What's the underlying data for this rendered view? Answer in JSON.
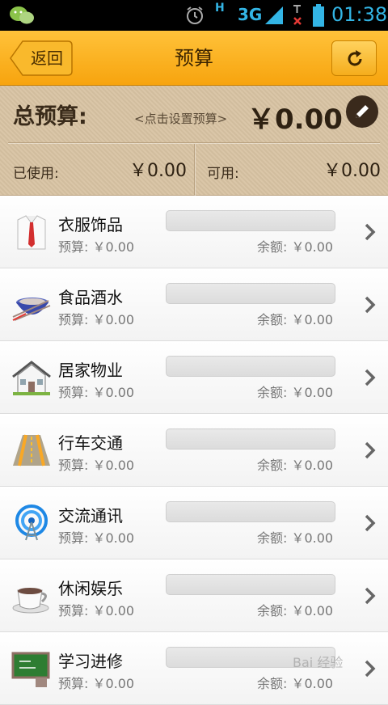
{
  "status_bar": {
    "network_type": "H",
    "network_gen": "3G",
    "time": "01:38"
  },
  "header": {
    "back_label": "返回",
    "title": "预算"
  },
  "summary": {
    "total_label": "总预算:",
    "set_hint": "<点击设置预算>",
    "total_amount": "￥0.00",
    "used_label": "已使用:",
    "used_value": "￥0.00",
    "available_label": "可用:",
    "available_value": "￥0.00"
  },
  "categories": [
    {
      "name": "衣服饰品",
      "budget": "预算: ￥0.00",
      "remaining": "余额: ￥0.00",
      "icon": "shirt-icon",
      "progress": 0
    },
    {
      "name": "食品酒水",
      "budget": "预算: ￥0.00",
      "remaining": "余额: ￥0.00",
      "icon": "food-bowl-icon",
      "progress": 0
    },
    {
      "name": "居家物业",
      "budget": "预算: ￥0.00",
      "remaining": "余额: ￥0.00",
      "icon": "house-icon",
      "progress": 0
    },
    {
      "name": "行车交通",
      "budget": "预算: ￥0.00",
      "remaining": "余额: ￥0.00",
      "icon": "road-icon",
      "progress": 0
    },
    {
      "name": "交流通讯",
      "budget": "预算: ￥0.00",
      "remaining": "余额: ￥0.00",
      "icon": "antenna-icon",
      "progress": 0
    },
    {
      "name": "休闲娱乐",
      "budget": "预算: ￥0.00",
      "remaining": "余额: ￥0.00",
      "icon": "coffee-icon",
      "progress": 0
    },
    {
      "name": "学习进修",
      "budget": "预算: ￥0.00",
      "remaining": "余额: ￥0.00",
      "icon": "chalkboard-icon",
      "progress": 0
    }
  ],
  "colors": {
    "header_bg": "#f7a40e",
    "summary_bg": "#d8c3a3",
    "status_accent": "#33b5e5"
  },
  "watermark": "Bai 经验"
}
